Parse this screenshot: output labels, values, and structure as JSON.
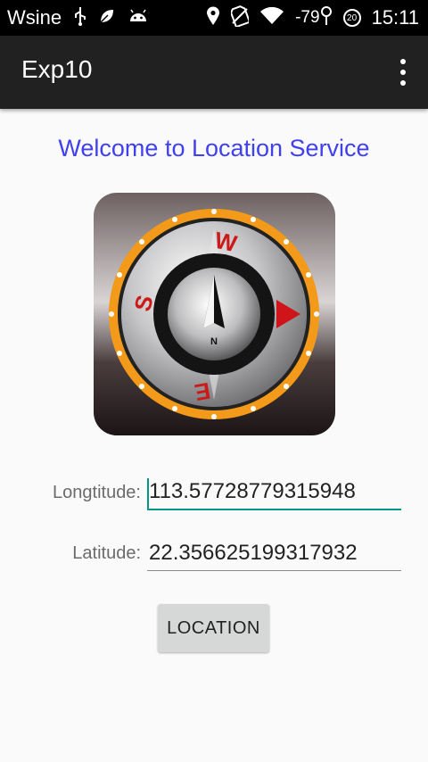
{
  "status_bar": {
    "carrier": "Wsine",
    "signal_strength": "-79",
    "notification_count": "20",
    "time": "15:11",
    "icons": [
      "usb-icon",
      "leaf-icon",
      "android-icon",
      "location-icon",
      "no-sim-icon",
      "wifi-icon",
      "signal-icon"
    ]
  },
  "app_bar": {
    "title": "Exp10",
    "overflow_icon": "more-vert-icon"
  },
  "main": {
    "welcome_text": "Welcome to Location Service",
    "compass_letters": {
      "north": "N",
      "east": "E",
      "south": "S",
      "west": "W"
    },
    "longitude": {
      "label": "Longtitude:",
      "value": "113.57728779315948"
    },
    "latitude": {
      "label": "Latitude:",
      "value": "22.356625199317932"
    },
    "location_button": "LOCATION"
  },
  "colors": {
    "welcome": "#4040ee",
    "accent": "#009688",
    "appbar": "#212121",
    "compass_ring": "#f39a1a",
    "compass_letters": "#cc1a1a"
  }
}
